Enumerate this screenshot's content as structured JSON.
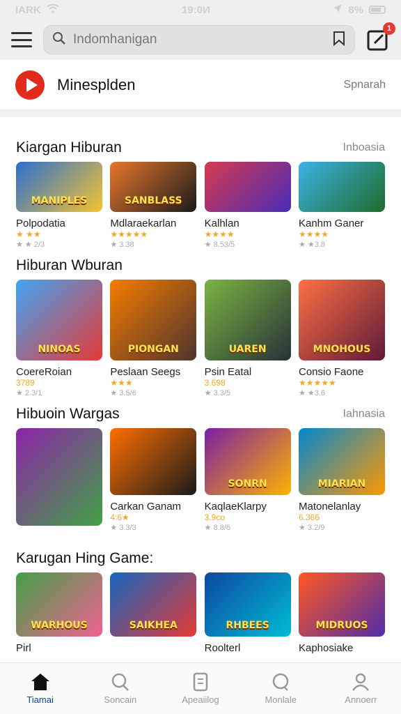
{
  "status": {
    "carrier": "IARK",
    "time": "19:0И",
    "battery": "8%"
  },
  "search": {
    "placeholder": "Indomhanigan",
    "notif_count": "1"
  },
  "app": {
    "name": "Minesplden",
    "right_label": "Spnarah"
  },
  "sections": [
    {
      "title": "Kiargan Hiburan",
      "more": "Inboasia",
      "items": [
        {
          "name": "Polpodatia",
          "rating": "★ ★★",
          "size": "★ ★ 2/3",
          "tag": "MANIPLES",
          "colors": [
            "#2c6fd1",
            "#f4c430"
          ]
        },
        {
          "name": "Mdlaraekarlan",
          "rating": "★★★★★",
          "size": "★ 3.38",
          "tag": "SANBLASS",
          "colors": [
            "#e6762b",
            "#1a1a1a"
          ]
        },
        {
          "name": "Kalhlan",
          "rating": "★★★★",
          "size": "★ 8.53/5",
          "tag": "",
          "colors": [
            "#d63a4d",
            "#4a2bb8"
          ]
        },
        {
          "name": "Kanhm Ganer",
          "rating": "★★★★",
          "size": "★ ★3.8",
          "tag": "",
          "colors": [
            "#3bb3e8",
            "#1f6b2a"
          ]
        }
      ]
    },
    {
      "title": "Hiburan Wburan",
      "more": "",
      "items": [
        {
          "name": "CoereRoian",
          "rating": "3789",
          "size": "★ 2.3/1",
          "tag": "NINOAS",
          "colors": [
            "#42a5f5",
            "#e53935"
          ]
        },
        {
          "name": "Peslaan Seegs",
          "rating": "★★★",
          "size": "★ 3.5/6",
          "tag": "PIONGAN",
          "colors": [
            "#f57c00",
            "#4e342e"
          ]
        },
        {
          "name": "Psin Eatal",
          "rating": "3.698",
          "size": "★ 3.3/5",
          "tag": "UAREN",
          "colors": [
            "#7cb342",
            "#263238"
          ]
        },
        {
          "name": "Consio Faone",
          "rating": "★★★★★",
          "size": "★ ★3.6",
          "tag": "MNOHOUS",
          "colors": [
            "#ff7043",
            "#5d1a3a"
          ]
        }
      ]
    },
    {
      "title": "Hibuoin Wargas",
      "more": "Iahnasia",
      "items": [
        {
          "name": "",
          "rating": "",
          "size": "",
          "tag": "",
          "colors": [
            "#8e24aa",
            "#43a047"
          ],
          "tall": true
        },
        {
          "name": "Carkan Ganam",
          "rating": "4:6★",
          "size": "★ 3.3/3",
          "tag": "",
          "colors": [
            "#ff6f00",
            "#1a1a1a"
          ]
        },
        {
          "name": "KaqlaeKlarpy",
          "rating": "3.9co",
          "size": "★ 8.8/6",
          "tag": "SONRN",
          "colors": [
            "#7b1fa2",
            "#ffb300"
          ]
        },
        {
          "name": "Matonelanlay",
          "rating": "6.366",
          "size": "★ 3.2/9",
          "tag": "MIARIAN",
          "colors": [
            "#0288d1",
            "#ff9800"
          ]
        }
      ]
    },
    {
      "title": "Karugan Hing Game:",
      "more": "",
      "items": [
        {
          "name": "Pirl",
          "rating": "",
          "size": "",
          "tag": "WARHOUS",
          "colors": [
            "#43a047",
            "#f06292"
          ]
        },
        {
          "name": "",
          "rating": "",
          "size": "",
          "tag": "SAIKHEA",
          "colors": [
            "#1565c0",
            "#e53935"
          ]
        },
        {
          "name": "Roolterl",
          "rating": "",
          "size": "",
          "tag": "RHBEES",
          "colors": [
            "#0d47a1",
            "#00bcd4"
          ]
        },
        {
          "name": "Kaphosiake",
          "rating": "",
          "size": "",
          "tag": "MIDRUOS",
          "colors": [
            "#ff5722",
            "#512da8"
          ]
        }
      ]
    }
  ],
  "nav": [
    {
      "label": "Tiamai",
      "icon": "home-icon",
      "active": true
    },
    {
      "label": "Soncain",
      "icon": "search-icon",
      "active": false
    },
    {
      "label": "Apeaiilog",
      "icon": "apps-icon",
      "active": false
    },
    {
      "label": "Monlale",
      "icon": "chat-icon",
      "active": false
    },
    {
      "label": "Annoerr",
      "icon": "person-icon",
      "active": false
    }
  ]
}
